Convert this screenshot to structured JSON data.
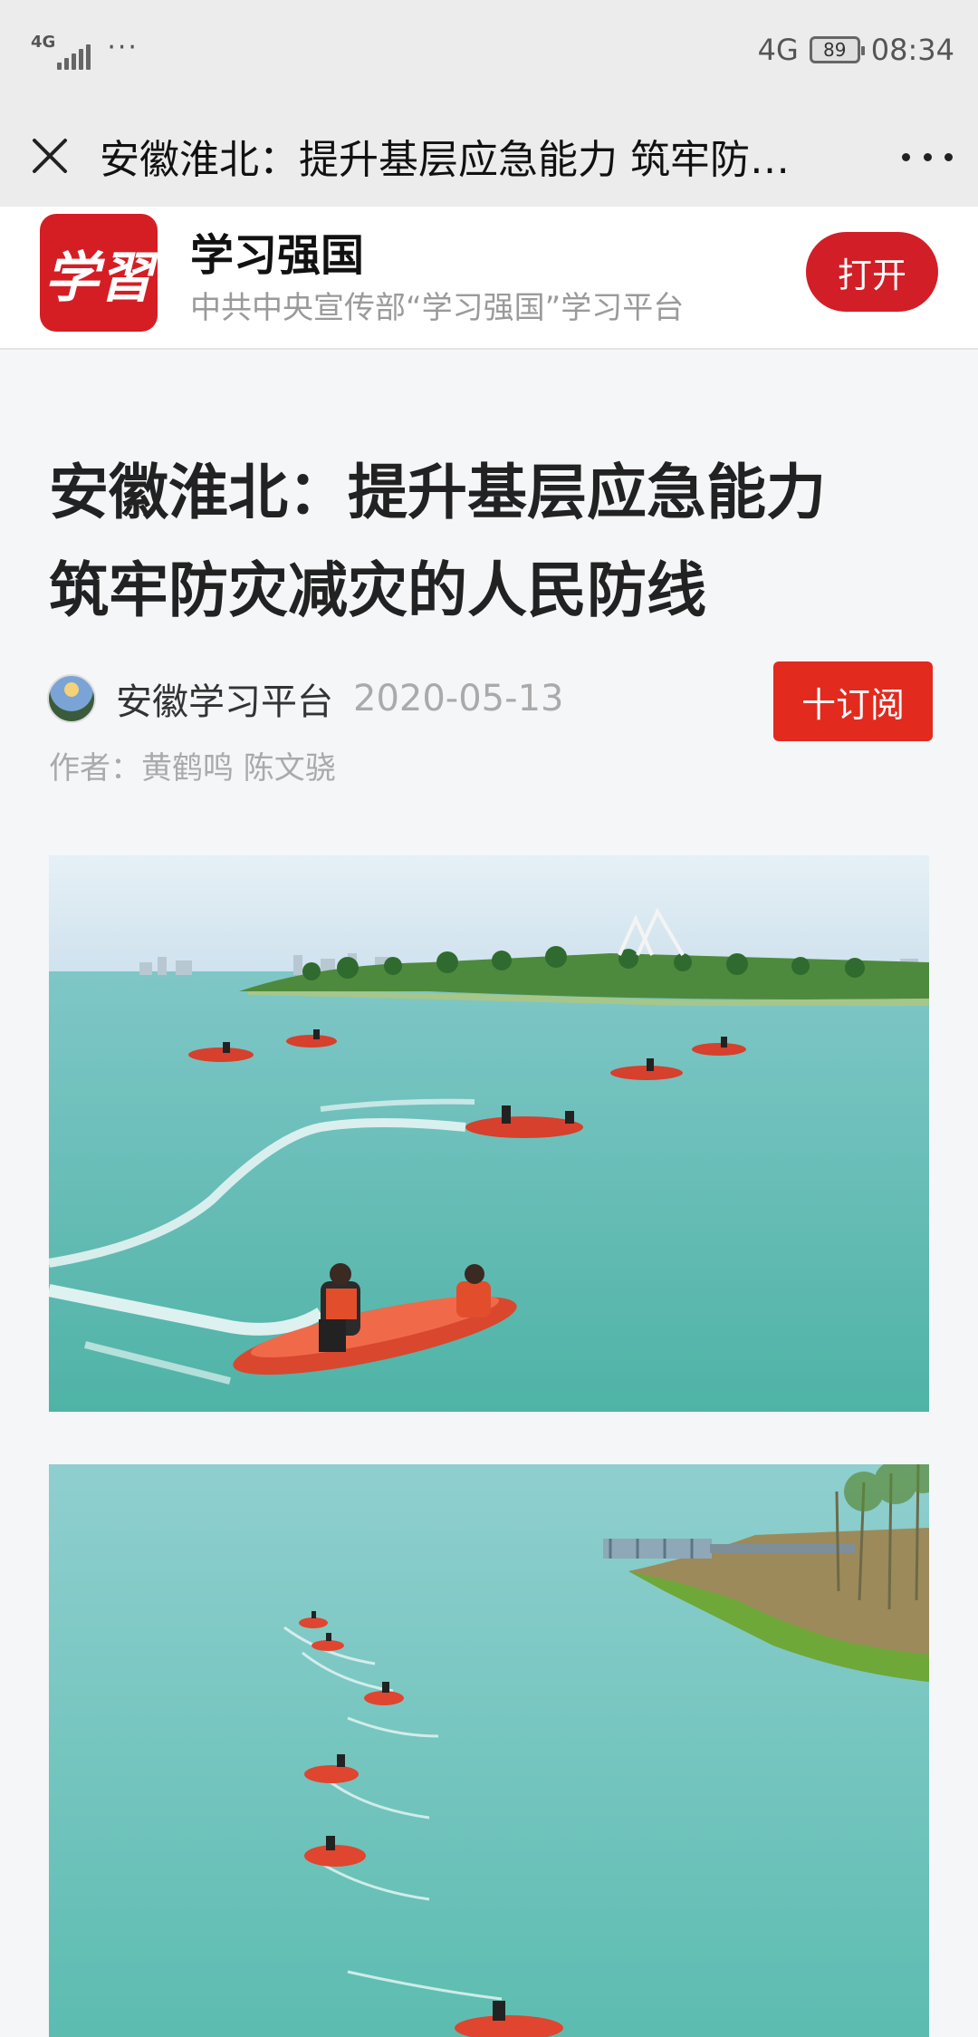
{
  "status_bar": {
    "network_left": "4G",
    "network_right": "4G",
    "battery": "89",
    "time": "08:34"
  },
  "title_bar": {
    "title": "安徽淮北：提升基层应急能力 筑牢防灾减灾的人民防线"
  },
  "app_banner": {
    "logo_text": "学習",
    "name": "学习强国",
    "description": "中共中央宣传部“学习强国”学习平台",
    "open_label": "打开"
  },
  "article": {
    "title_line1": "安徽淮北：提升基层应急能力",
    "title_line2": "筑牢防灾减灾的人民防线",
    "source": "安徽学习平台",
    "date": "2020-05-13",
    "subscribe_label": "十订阅",
    "authors": "作者：黄鹤鸣 陈文骁"
  },
  "colors": {
    "brand_red": "#d51e24",
    "subscribe_red": "#e22a1f",
    "water": "#5fbfb5"
  }
}
